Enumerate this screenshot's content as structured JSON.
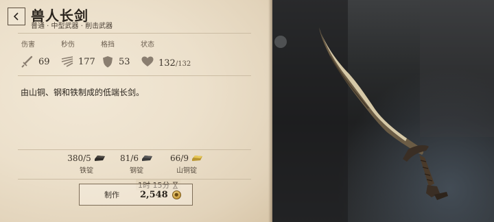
{
  "item": {
    "title": "兽人长剑",
    "subtitle": "普通 · 中型武器 · 削击武器",
    "description": "由山铜、钢和铁制成的低端长剑。"
  },
  "stats": {
    "damage": {
      "label": "伤害",
      "value": "69",
      "icon": "sword-icon"
    },
    "dps": {
      "label": "秒伤",
      "value": "177",
      "icon": "speed-lines-icon"
    },
    "block": {
      "label": "格挡",
      "value": "53",
      "icon": "shield-icon"
    },
    "condition": {
      "label": "状态",
      "value": "132",
      "max": "/132",
      "icon": "heart-icon"
    }
  },
  "materials": [
    {
      "count": "380/5",
      "name": "铁锭",
      "icon": "iron-ingot-icon"
    },
    {
      "count": "81/6",
      "name": "钢锭",
      "icon": "steel-ingot-icon"
    },
    {
      "count": "66/9",
      "name": "山铜锭",
      "icon": "orichalcum-ingot-icon"
    }
  ],
  "craft": {
    "time": "1时 15分",
    "label": "制作",
    "cost": "2,548",
    "currency_icon": "gold-coin-icon"
  },
  "colors": {
    "parchment": "#ece0cb",
    "text_dark": "#2a241d",
    "accent_gold": "#c89b3c"
  }
}
